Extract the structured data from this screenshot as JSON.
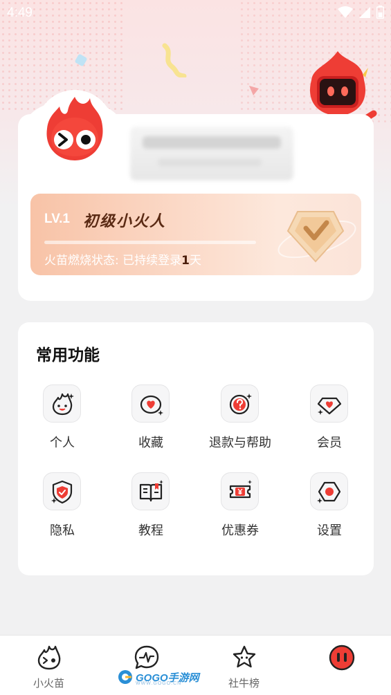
{
  "status_bar": {
    "time": "4:49"
  },
  "profile": {
    "level_tag": "LV.1",
    "level_name": "初级小火人",
    "level_progress": 0,
    "burn_prefix": "火苗燃烧状态: 已持续登录",
    "burn_days": "1",
    "burn_suffix": "天"
  },
  "functions": {
    "title": "常用功能",
    "items": [
      {
        "label": "个人",
        "icon": "flame-face-icon"
      },
      {
        "label": "收藏",
        "icon": "heart-icon"
      },
      {
        "label": "退款与帮助",
        "icon": "question-icon"
      },
      {
        "label": "会员",
        "icon": "diamond-heart-icon"
      },
      {
        "label": "隐私",
        "icon": "shield-check-icon"
      },
      {
        "label": "教程",
        "icon": "book-icon"
      },
      {
        "label": "优惠券",
        "icon": "coupon-icon"
      },
      {
        "label": "设置",
        "icon": "hexagon-settings-icon"
      }
    ]
  },
  "bottom_nav": {
    "items": [
      {
        "label": "小火苗",
        "icon": "flame-icon"
      },
      {
        "label": "",
        "icon": "chat-pulse-icon"
      },
      {
        "label": "社牛榜",
        "icon": "star-icon"
      },
      {
        "label": "",
        "icon": "profile-avatar-icon"
      }
    ]
  },
  "watermark": {
    "text": "GOGO手游网",
    "sub": "WWW.GOGO.CN"
  },
  "colors": {
    "accent": "#e8352b",
    "level_text": "#5a2a14"
  }
}
